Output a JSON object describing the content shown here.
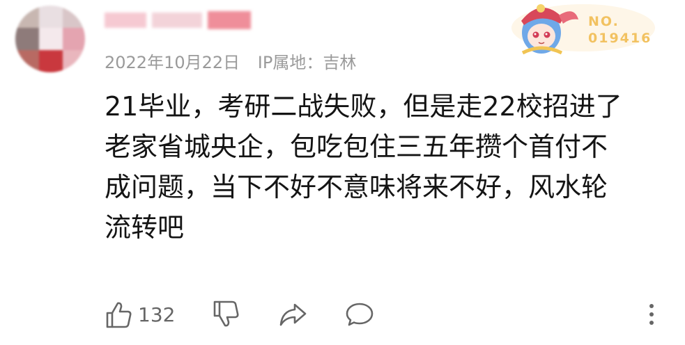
{
  "comment": {
    "date": "2022年10月22日",
    "ip_location": "IP属地：吉林",
    "badge": {
      "prefix": "NO.",
      "number": "019416"
    },
    "text_lines": [
      "21毕业，考研二战失败，但是走22校招进了",
      "老家省城央企，包吃包住三五年攒个首付不",
      "成问题，当下不好不意味将来不好，风水轮",
      "流转吧"
    ]
  },
  "actions": {
    "like_count": "132",
    "icons": [
      "thumbs-up-icon",
      "thumbs-down-icon",
      "share-icon",
      "reply-icon",
      "more-icon"
    ]
  },
  "colors": {
    "badge_gold": "#f2c261",
    "meta_gray": "#9a9a9a",
    "text": "#141414",
    "icon": "#666666"
  }
}
